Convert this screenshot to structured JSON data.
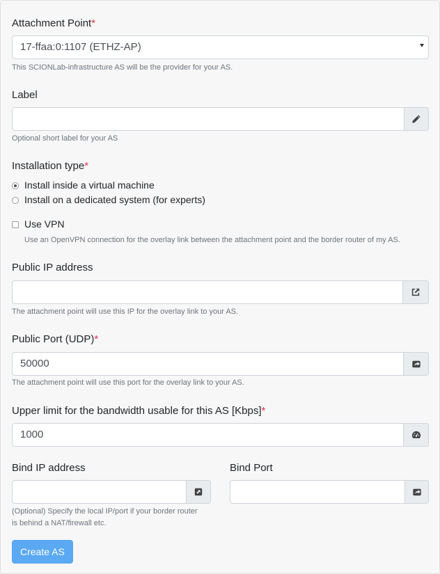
{
  "form": {
    "attachment_point": {
      "label": "Attachment Point",
      "required_mark": "*",
      "value": "17-ffaa:0:1107 (ETHZ-AP)",
      "help": "This SCIONLab-infrastructure AS will be the provider for your AS."
    },
    "label_field": {
      "label": "Label",
      "value": "",
      "help": "Optional short label for your AS",
      "icon": "pencil-icon"
    },
    "installation_type": {
      "label": "Installation type",
      "required_mark": "*",
      "options": [
        {
          "label": "Install inside a virtual machine",
          "selected": true
        },
        {
          "label": "Install on a dedicated system (for experts)",
          "selected": false
        }
      ]
    },
    "use_vpn": {
      "label": "Use VPN",
      "checked": false,
      "help": "Use an OpenVPN connection for the overlay link between the attachment point and the border router of my AS."
    },
    "public_ip": {
      "label": "Public IP address",
      "value": "",
      "help": "The attachment point will use this IP for the overlay link to your AS.",
      "icon": "external-link-icon"
    },
    "public_port": {
      "label": "Public Port (UDP)",
      "required_mark": "*",
      "value": "50000",
      "help": "The attachment point will use this port for the overlay link to your AS.",
      "icon": "share-square-icon"
    },
    "bandwidth": {
      "label": "Upper limit for the bandwidth usable for this AS [Kbps]",
      "required_mark": "*",
      "value": "1000",
      "icon": "tachometer-icon"
    },
    "bind_ip": {
      "label": "Bind IP address",
      "value": "",
      "help_line1": "(Optional) Specify the local IP/port if your border router",
      "help_line2": "is behind a NAT/firewall etc.",
      "icon": "external-link-square-icon"
    },
    "bind_port": {
      "label": "Bind Port",
      "value": "",
      "icon": "share-square-icon"
    },
    "submit_label": "Create AS"
  },
  "colors": {
    "accent": "#5aa9f2",
    "required": "#dc3545",
    "help_text": "#6c757d",
    "card_bg": "#f7f7f7"
  }
}
